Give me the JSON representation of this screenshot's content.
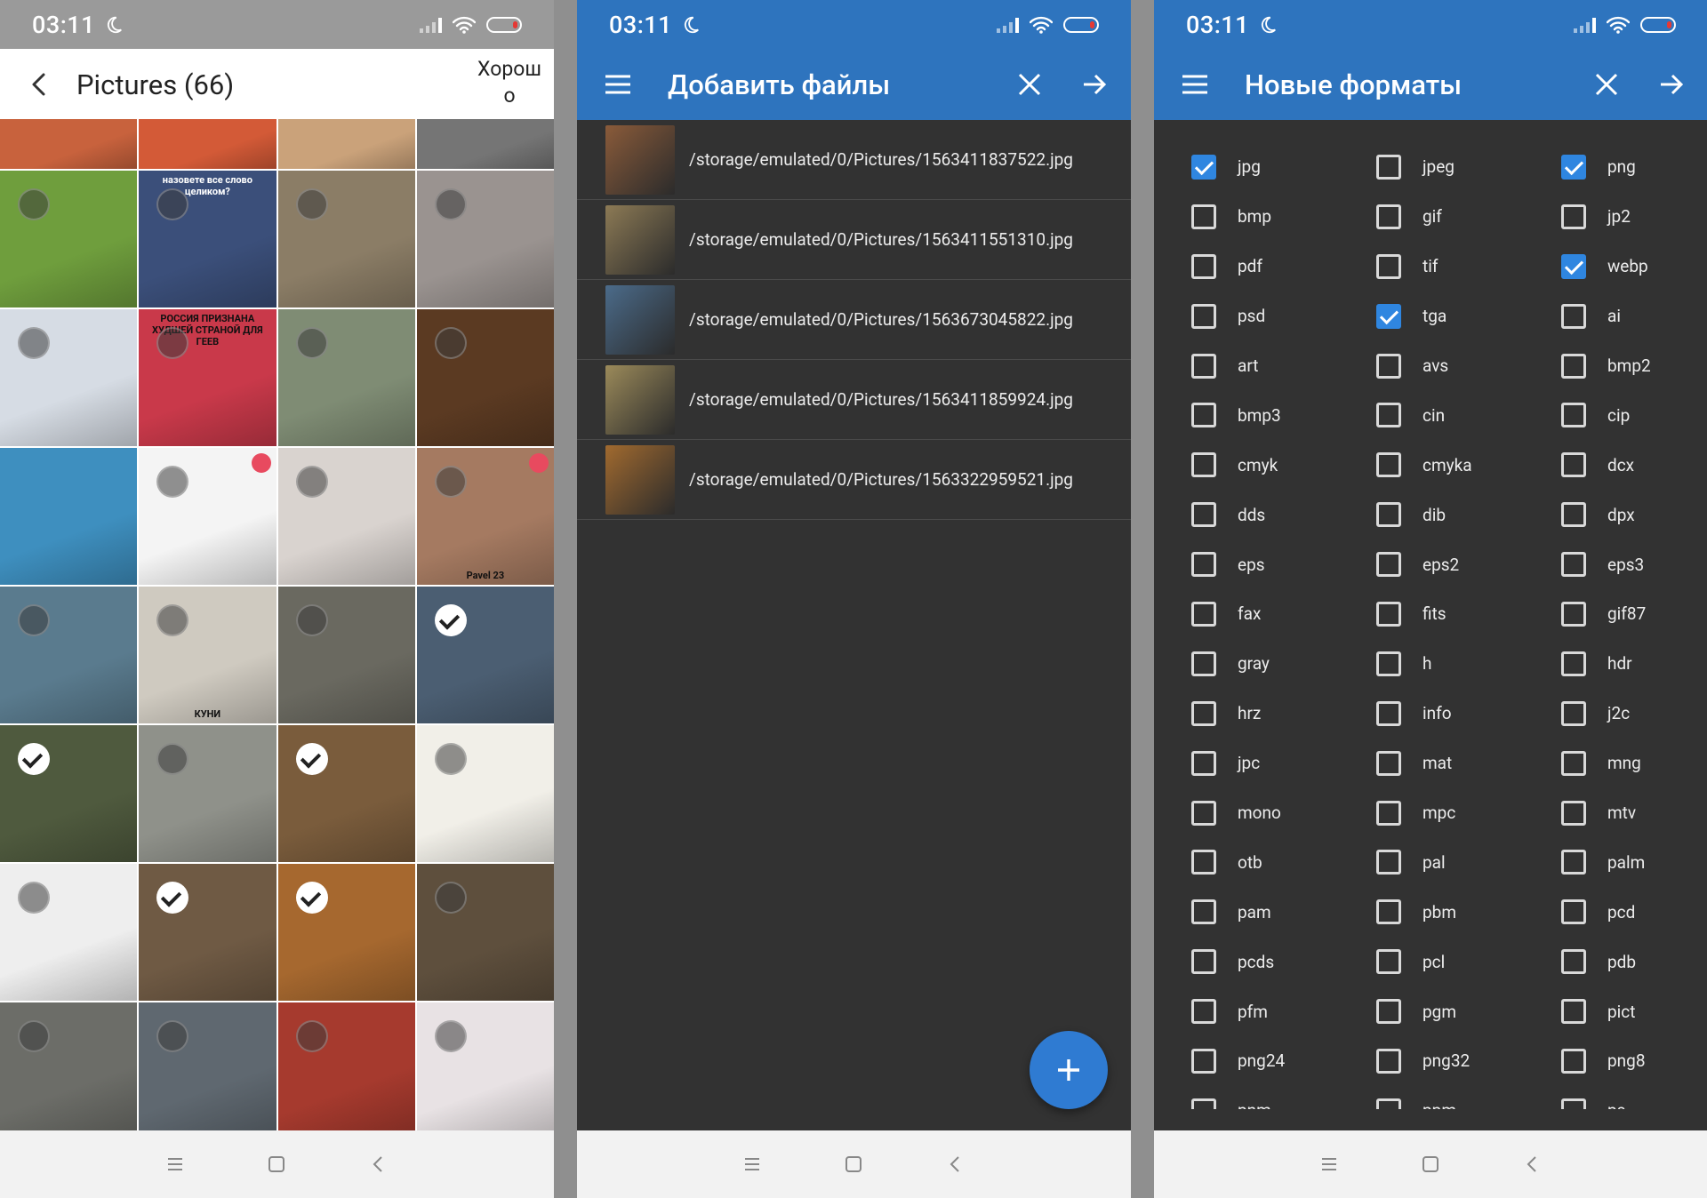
{
  "status": {
    "time": "03:11"
  },
  "gallery": {
    "title": "Pictures (66)",
    "ok_label": "Хорошо",
    "rows": [
      [
        {
          "bg": "#c8623d"
        },
        {
          "bg": "#d35a37"
        },
        {
          "bg": "#caa27a"
        },
        {
          "bg": "#757575"
        }
      ],
      [
        {
          "bg": "#6f9e3d",
          "sel": "off"
        },
        {
          "bg": "#3b4f7a",
          "sel": "off",
          "caption": "назовете все слово целиком?",
          "cap_pos": "top"
        },
        {
          "bg": "#8b7d66",
          "sel": "off"
        },
        {
          "bg": "#9a9390",
          "sel": "off"
        }
      ],
      [
        {
          "bg": "#d6dce4",
          "sel": "off"
        },
        {
          "bg": "#c9394a",
          "sel": "off",
          "caption": "РОССИЯ ПРИЗНАНА ХУДШЕЙ СТРАНОЙ ДЛЯ ГЕЕВ",
          "cap_pos": "top",
          "cap_dark": true
        },
        {
          "bg": "#7f8c74",
          "sel": "off"
        },
        {
          "bg": "#5b3a22",
          "sel": "off"
        }
      ],
      [
        {
          "bg": "#3e8fbf"
        },
        {
          "bg": "#f4f4f4",
          "sel": "off",
          "heart": true
        },
        {
          "bg": "#d9d3cf",
          "sel": "off"
        },
        {
          "bg": "#a57a61",
          "sel": "off",
          "heart": true,
          "caption": "Pavel 23",
          "cap_pos": "bottom",
          "cap_dark": true
        }
      ],
      [
        {
          "bg": "#5a7b8e",
          "sel": "off"
        },
        {
          "bg": "#cfcac0",
          "sel": "off",
          "caption": "КУНИ",
          "cap_pos": "bottom",
          "cap_dark": true
        },
        {
          "bg": "#6a6960",
          "sel": "off"
        },
        {
          "bg": "#4b5e72",
          "sel": "on"
        }
      ],
      [
        {
          "bg": "#4f5a3e",
          "sel": "on"
        },
        {
          "bg": "#8f918a",
          "sel": "off"
        },
        {
          "bg": "#7a5c3c",
          "sel": "on"
        },
        {
          "bg": "#f1efe8",
          "sel": "off"
        }
      ],
      [
        {
          "bg": "#eeeeee",
          "sel": "off"
        },
        {
          "bg": "#6f5a44",
          "sel": "on"
        },
        {
          "bg": "#a6682f",
          "sel": "on"
        },
        {
          "bg": "#5e4f3d",
          "sel": "off"
        }
      ],
      [
        {
          "bg": "#6c6d68",
          "sel": "off"
        },
        {
          "bg": "#5f6870",
          "sel": "off"
        },
        {
          "bg": "#a63a2e",
          "sel": "off"
        },
        {
          "bg": "#e8e2e4",
          "sel": "off"
        }
      ]
    ]
  },
  "add_files": {
    "title": "Добавить файлы",
    "files": [
      {
        "path": "/storage/emulated/0/Pictures/1563411837522.jpg",
        "color": "#8a5b3a"
      },
      {
        "path": "/storage/emulated/0/Pictures/1563411551310.jpg",
        "color": "#8c7a55"
      },
      {
        "path": "/storage/emulated/0/Pictures/1563673045822.jpg",
        "color": "#4b6b8a"
      },
      {
        "path": "/storage/emulated/0/Pictures/1563411859924.jpg",
        "color": "#9b8a5a"
      },
      {
        "path": "/storage/emulated/0/Pictures/1563322959521.jpg",
        "color": "#a16a2f"
      }
    ]
  },
  "formats": {
    "title": "Новые форматы",
    "items": [
      {
        "label": "jpg",
        "checked": true
      },
      {
        "label": "jpeg",
        "checked": false
      },
      {
        "label": "png",
        "checked": true
      },
      {
        "label": "bmp",
        "checked": false
      },
      {
        "label": "gif",
        "checked": false
      },
      {
        "label": "jp2",
        "checked": false
      },
      {
        "label": "pdf",
        "checked": false
      },
      {
        "label": "tif",
        "checked": false
      },
      {
        "label": "webp",
        "checked": true
      },
      {
        "label": "psd",
        "checked": false
      },
      {
        "label": "tga",
        "checked": true
      },
      {
        "label": "ai",
        "checked": false
      },
      {
        "label": "art",
        "checked": false
      },
      {
        "label": "avs",
        "checked": false
      },
      {
        "label": "bmp2",
        "checked": false
      },
      {
        "label": "bmp3",
        "checked": false
      },
      {
        "label": "cin",
        "checked": false
      },
      {
        "label": "cip",
        "checked": false
      },
      {
        "label": "cmyk",
        "checked": false
      },
      {
        "label": "cmyka",
        "checked": false
      },
      {
        "label": "dcx",
        "checked": false
      },
      {
        "label": "dds",
        "checked": false
      },
      {
        "label": "dib",
        "checked": false
      },
      {
        "label": "dpx",
        "checked": false
      },
      {
        "label": "eps",
        "checked": false
      },
      {
        "label": "eps2",
        "checked": false
      },
      {
        "label": "eps3",
        "checked": false
      },
      {
        "label": "fax",
        "checked": false
      },
      {
        "label": "fits",
        "checked": false
      },
      {
        "label": "gif87",
        "checked": false
      },
      {
        "label": "gray",
        "checked": false
      },
      {
        "label": "h",
        "checked": false
      },
      {
        "label": "hdr",
        "checked": false
      },
      {
        "label": "hrz",
        "checked": false
      },
      {
        "label": "info",
        "checked": false
      },
      {
        "label": "j2c",
        "checked": false
      },
      {
        "label": "jpc",
        "checked": false
      },
      {
        "label": "mat",
        "checked": false
      },
      {
        "label": "mng",
        "checked": false
      },
      {
        "label": "mono",
        "checked": false
      },
      {
        "label": "mpc",
        "checked": false
      },
      {
        "label": "mtv",
        "checked": false
      },
      {
        "label": "otb",
        "checked": false
      },
      {
        "label": "pal",
        "checked": false
      },
      {
        "label": "palm",
        "checked": false
      },
      {
        "label": "pam",
        "checked": false
      },
      {
        "label": "pbm",
        "checked": false
      },
      {
        "label": "pcd",
        "checked": false
      },
      {
        "label": "pcds",
        "checked": false
      },
      {
        "label": "pcl",
        "checked": false
      },
      {
        "label": "pdb",
        "checked": false
      },
      {
        "label": "pfm",
        "checked": false
      },
      {
        "label": "pgm",
        "checked": false
      },
      {
        "label": "pict",
        "checked": false
      },
      {
        "label": "png24",
        "checked": false
      },
      {
        "label": "png32",
        "checked": false
      },
      {
        "label": "png8",
        "checked": false
      },
      {
        "label": "pnm",
        "checked": false
      },
      {
        "label": "ppm",
        "checked": false
      },
      {
        "label": "ps",
        "checked": false
      }
    ]
  },
  "colors": {
    "accent": "#2e74be",
    "fab": "#2f7bd2",
    "dark_bg": "#323232"
  }
}
